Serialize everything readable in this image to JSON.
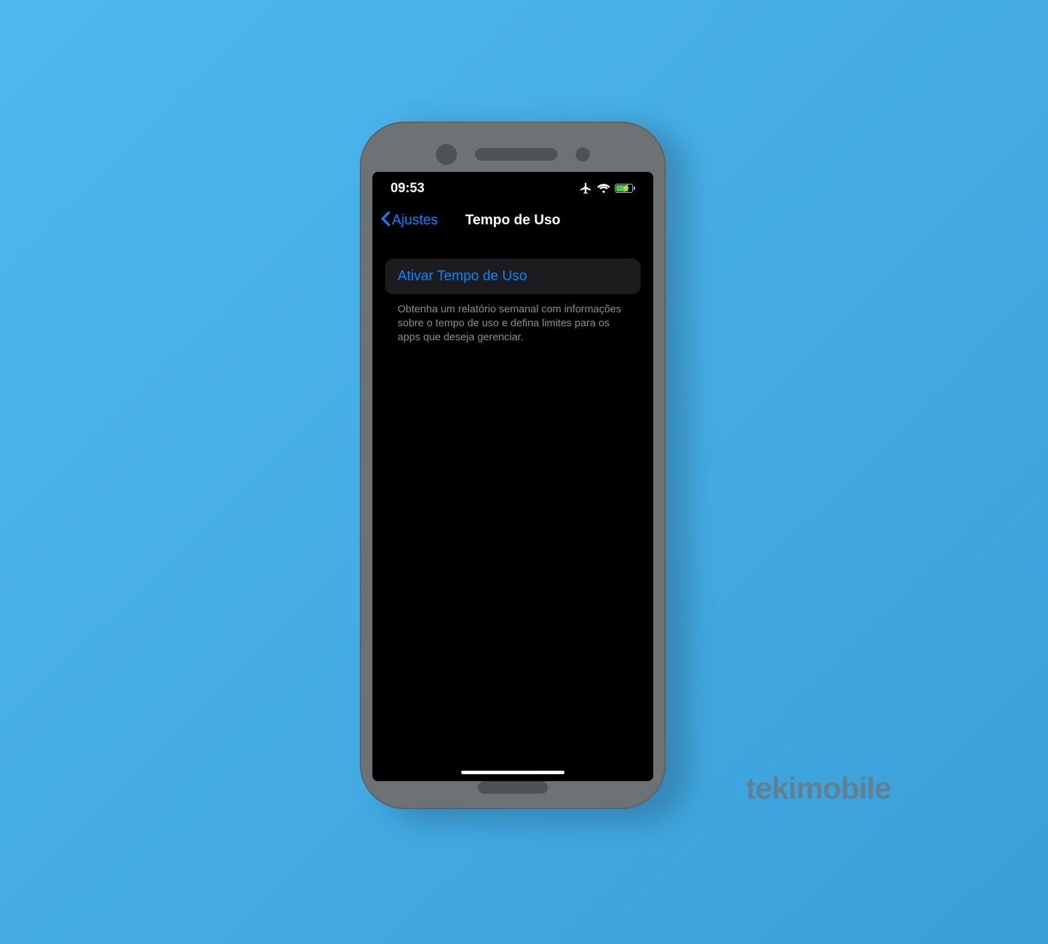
{
  "status": {
    "time": "09:53"
  },
  "nav": {
    "back_label": "Ajustes",
    "title": "Tempo de Uso"
  },
  "main": {
    "activate_label": "Ativar Tempo de Uso",
    "description": "Obtenha um relatório semanal com informações sobre o tempo de uso e defina limites para os apps que deseja gerenciar."
  },
  "watermark": "tekimobile"
}
